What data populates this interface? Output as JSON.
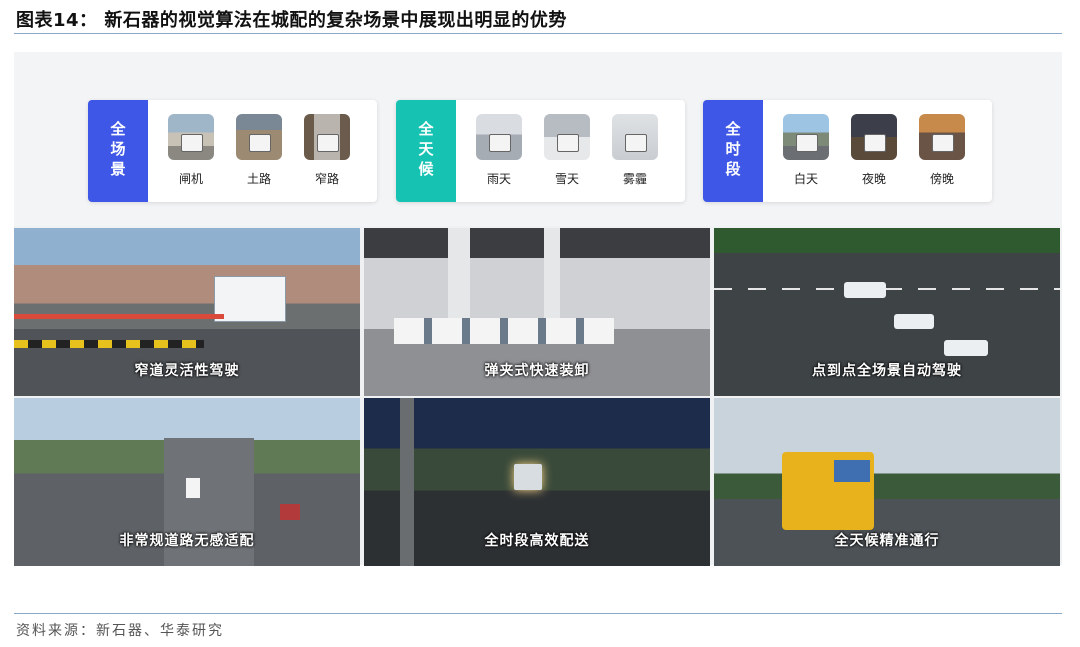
{
  "title": "图表14：  新石器的视觉算法在城配的复杂场景中展现出明显的优势",
  "source": "资料来源：新石器、华泰研究",
  "categories": [
    {
      "tag": "全场景",
      "color": "#3f57e6",
      "items": [
        {
          "label": "闸机"
        },
        {
          "label": "土路"
        },
        {
          "label": "窄路"
        }
      ]
    },
    {
      "tag": "全天候",
      "color": "#16c2b2",
      "items": [
        {
          "label": "雨天"
        },
        {
          "label": "雪天"
        },
        {
          "label": "雾霾"
        }
      ]
    },
    {
      "tag": "全时段",
      "color": "#3f57e6",
      "items": [
        {
          "label": "白天"
        },
        {
          "label": "夜晚"
        },
        {
          "label": "傍晚"
        }
      ]
    }
  ],
  "scenes": [
    {
      "caption": "窄道灵活性驾驶"
    },
    {
      "caption": "弹夹式快速装卸"
    },
    {
      "caption": "点到点全场景自动驾驶"
    },
    {
      "caption": "非常规道路无感适配"
    },
    {
      "caption": "全时段高效配送"
    },
    {
      "caption": "全天候精准通行"
    }
  ]
}
